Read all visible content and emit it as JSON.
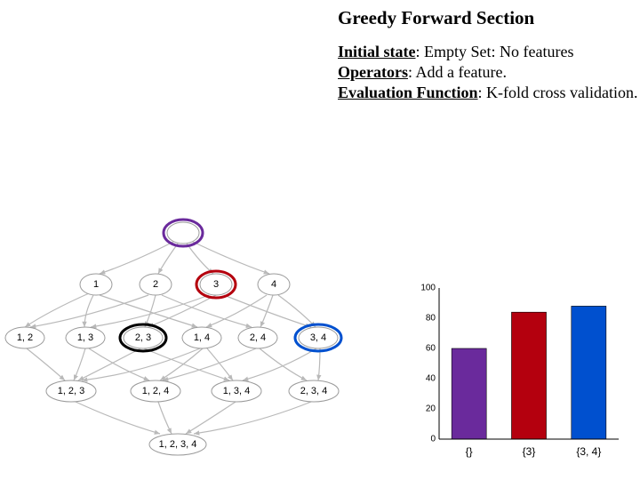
{
  "title": "Greedy Forward Section",
  "desc": {
    "initial_label": "Initial state",
    "initial_value": ": Empty Set: No features",
    "operators_label": "Operators",
    "operators_value": ": Add a feature.",
    "eval_label": "Evaluation Function",
    "eval_value": ": K-fold cross validation."
  },
  "lattice": {
    "nodes": {
      "root": "",
      "n1": "1",
      "n2": "2",
      "n3": "3",
      "n4": "4",
      "n12": "1, 2",
      "n13": "1, 3",
      "n23": "2, 3",
      "n14": "1, 4",
      "n24": "2, 4",
      "n34": "3, 4",
      "n123": "1, 2, 3",
      "n124": "1, 2, 4",
      "n134": "1, 3, 4",
      "n234": "2, 3, 4",
      "n1234": "1, 2, 3, 4"
    },
    "highlights": {
      "root": "#6a2a9c",
      "n3": "#b4000e",
      "n23": "#000000",
      "n34": "#0050cf"
    }
  },
  "chart_data": {
    "type": "bar",
    "categories": [
      "{}",
      "{3}",
      "{3, 4}"
    ],
    "values": [
      60,
      84,
      88
    ],
    "colors": [
      "#6a2a9c",
      "#b4000e",
      "#0050cf"
    ],
    "ylim": [
      0,
      100
    ],
    "yticks": [
      0,
      20,
      40,
      60,
      80,
      100
    ],
    "title": "",
    "xlabel": "",
    "ylabel": ""
  }
}
